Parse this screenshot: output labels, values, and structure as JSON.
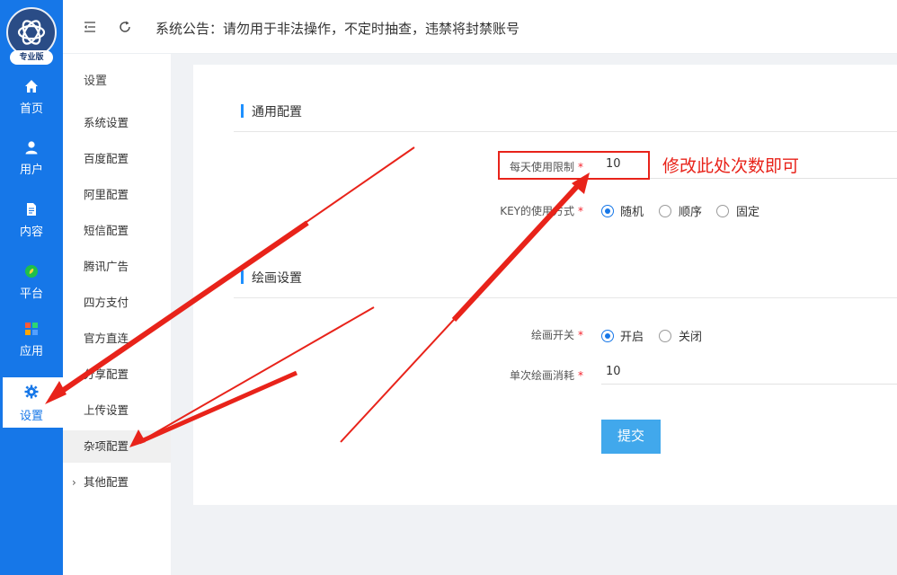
{
  "brand": {
    "badge": "专业版"
  },
  "nav": [
    {
      "label": "首页",
      "icon": "home-icon"
    },
    {
      "label": "用户",
      "icon": "user-icon"
    },
    {
      "label": "内容",
      "icon": "document-icon"
    },
    {
      "label": "平台",
      "icon": "platform-icon"
    },
    {
      "label": "应用",
      "icon": "apps-icon"
    },
    {
      "label": "设置",
      "icon": "gear-icon",
      "active": true
    }
  ],
  "header": {
    "notice": "系统公告：请勿用于非法操作，不定时抽查，违禁将封禁账号"
  },
  "sub": {
    "title": "设置",
    "items": [
      "系统设置",
      "百度配置",
      "阿里配置",
      "短信配置",
      "腾讯广告",
      "四方支付",
      "官方直连",
      "分享配置",
      "上传设置",
      "杂项配置"
    ],
    "active": "杂项配置",
    "more": "其他配置"
  },
  "general": {
    "title": "通用配置",
    "daily_limit": {
      "label": "每天使用限制",
      "value": "10"
    },
    "key_mode": {
      "label": "KEY的使用方式",
      "options": [
        "随机",
        "顺序",
        "固定"
      ],
      "selected": "随机"
    }
  },
  "drawing": {
    "title": "绘画设置",
    "switch": {
      "label": "绘画开关",
      "options": [
        "开启",
        "关闭"
      ],
      "selected": "开启"
    },
    "cost": {
      "label": "单次绘画消耗",
      "value": "10"
    }
  },
  "submit_label": "提交",
  "annotation": {
    "text": "修改此处次数即可"
  },
  "colors": {
    "nav": "#1677e8",
    "accent": "#41a8ec",
    "annotation": "#e8231a"
  }
}
